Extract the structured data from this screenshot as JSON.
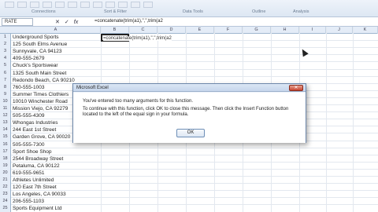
{
  "ribbon": {
    "groups": [
      "Connections",
      "Sort & Filter",
      "Data Tools",
      "Outline",
      "Analysis"
    ]
  },
  "formula_bar": {
    "name_box": "RATE",
    "cancel_icon": "✕",
    "enter_icon": "✓",
    "fx_label": "fx",
    "formula": "=concatenate(trim(a1),\",\",trim(a2"
  },
  "columns": [
    "A",
    "B",
    "C",
    "D",
    "E",
    "F",
    "G",
    "H",
    "I",
    "J",
    "K"
  ],
  "rows": [
    {
      "num": "1",
      "a": "Underground Sports"
    },
    {
      "num": "2",
      "a": "125 South Elms Avenue"
    },
    {
      "num": "3",
      "a": "Sunnyvale, CA 94123"
    },
    {
      "num": "4",
      "a": "409-555-2679"
    },
    {
      "num": "5",
      "a": "Chuck's Sportswear"
    },
    {
      "num": "6",
      "a": "1325 South Main Street"
    },
    {
      "num": "7",
      "a": "Redondo Beach, CA 90210"
    },
    {
      "num": "8",
      "a": "760-555-1003"
    },
    {
      "num": "9",
      "a": "Summer Times Clothiers"
    },
    {
      "num": "10",
      "a": "10010 Winchester Road"
    },
    {
      "num": "11",
      "a": "Mission Viejo, CA 92279"
    },
    {
      "num": "12",
      "a": "505-555-4309"
    },
    {
      "num": "13",
      "a": "Whongas Industries"
    },
    {
      "num": "14",
      "a": "244 East 1st Street"
    },
    {
      "num": "15",
      "a": "Garden Grove, CA 90020"
    },
    {
      "num": "16",
      "a": "505-555-7300"
    },
    {
      "num": "17",
      "a": "Sport Shoe Shop"
    },
    {
      "num": "18",
      "a": "2544 Broadway Street"
    },
    {
      "num": "19",
      "a": "Petaluma, CA 90122"
    },
    {
      "num": "20",
      "a": "619-555-9651"
    },
    {
      "num": "21",
      "a": "Athletes Unlimited"
    },
    {
      "num": "22",
      "a": "120 East 7th Street"
    },
    {
      "num": "23",
      "a": "Los Angeles, CA 90033"
    },
    {
      "num": "24",
      "a": "206-555-1103"
    },
    {
      "num": "25",
      "a": "Sports Equipment Ltd"
    }
  ],
  "active_cell": {
    "text": "=concatenate(trim(a1),\",\",trim(a2"
  },
  "dialog": {
    "title": "Microsoft Excel",
    "close_label": "✕",
    "message_1": "You've entered too many arguments for this function.",
    "message_2": "To continue with this function, click OK to close this message. Then click the Insert Function button located to the left of the equal sign in your formula.",
    "ok_label": "OK"
  }
}
